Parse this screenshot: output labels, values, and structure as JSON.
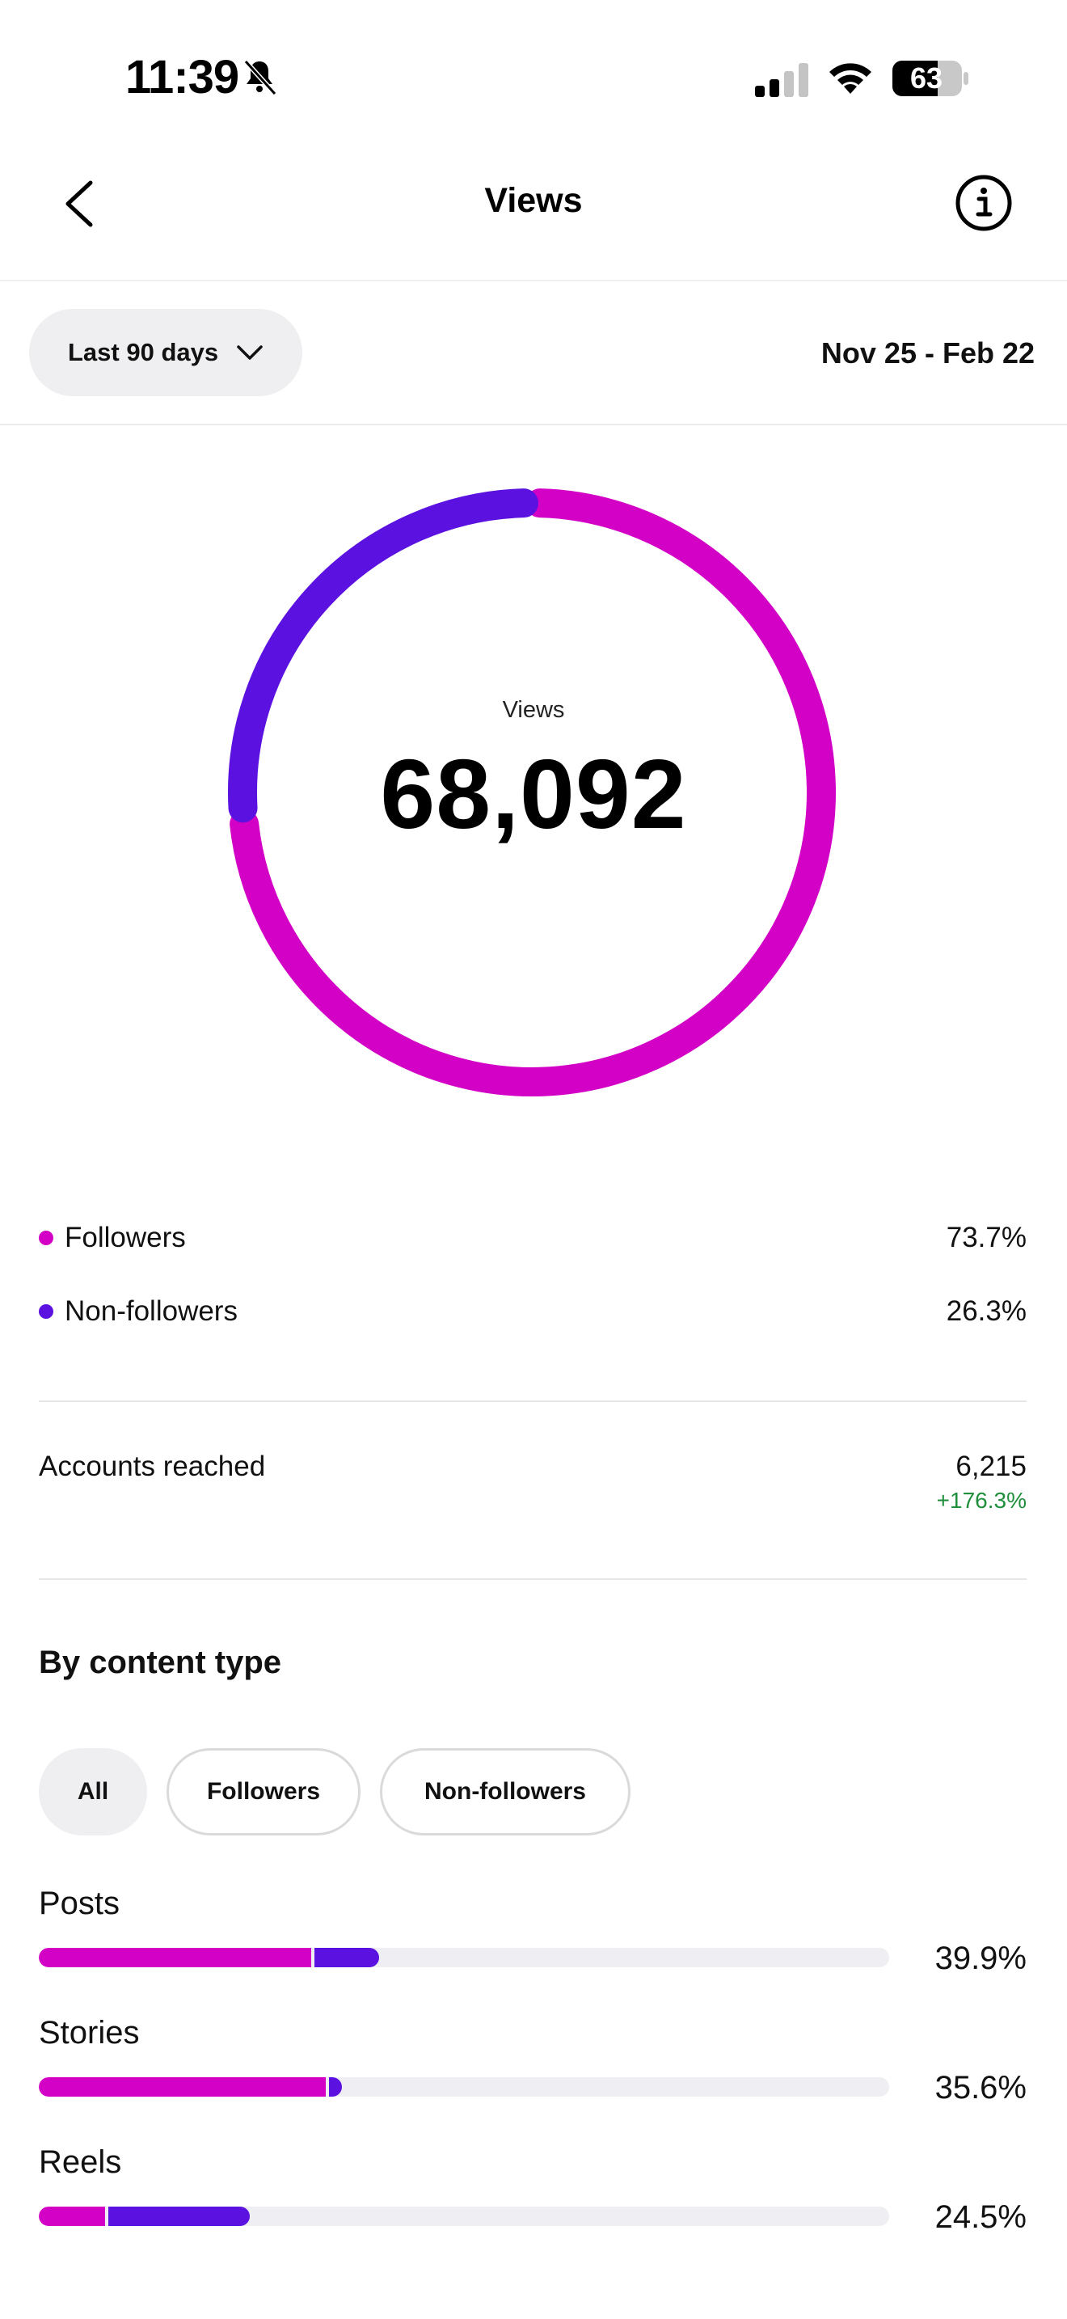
{
  "status_bar": {
    "time": "11:39",
    "battery": "63"
  },
  "header": {
    "title": "Views"
  },
  "filter": {
    "range_label": "Last 90 days",
    "date_range": "Nov 25 - Feb 22"
  },
  "colors": {
    "followers": "#d300c5",
    "non_followers": "#5b12e0",
    "positive": "#1f8f3b"
  },
  "summary": {
    "label": "Views",
    "value": "68,092",
    "breakdown": [
      {
        "label": "Followers",
        "value": "73.7%",
        "share": 73.7
      },
      {
        "label": "Non-followers",
        "value": "26.3%",
        "share": 26.3
      }
    ]
  },
  "accounts_reached": {
    "label": "Accounts reached",
    "value": "6,215",
    "change": "+176.3%"
  },
  "content_type": {
    "title": "By content type",
    "filters": [
      "All",
      "Followers",
      "Non-followers"
    ],
    "active_filter": "All",
    "rows": [
      {
        "label": "Posts",
        "value": "39.9%",
        "total": 39.9,
        "followers_fraction": 0.32,
        "non_followers_fraction": 0.08
      },
      {
        "label": "Stories",
        "value": "35.6%",
        "total": 35.6,
        "followers_fraction": 0.337,
        "non_followers_fraction": 0.019
      },
      {
        "label": "Reels",
        "value": "24.5%",
        "total": 24.5,
        "followers_fraction": 0.078,
        "non_followers_fraction": 0.17
      }
    ]
  }
}
